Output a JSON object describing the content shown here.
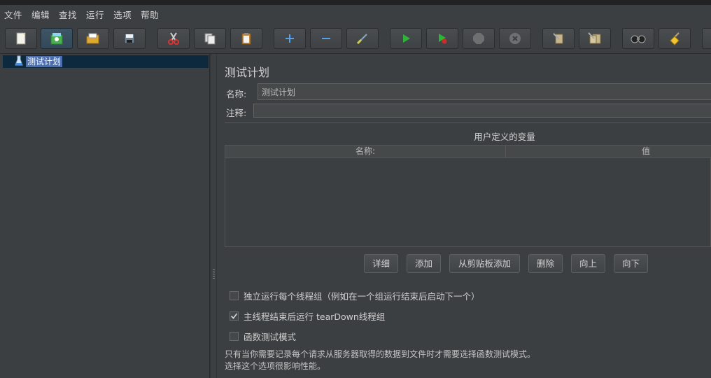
{
  "menu": [
    "文件",
    "编辑",
    "查找",
    "运行",
    "选项",
    "帮助"
  ],
  "toolbar": [
    {
      "name": "new-icon"
    },
    {
      "name": "templates-icon"
    },
    {
      "name": "open-icon"
    },
    {
      "name": "save-icon"
    },
    {
      "name": "cut-icon"
    },
    {
      "name": "copy-icon"
    },
    {
      "name": "paste-icon"
    },
    {
      "name": "expand-icon"
    },
    {
      "name": "collapse-icon"
    },
    {
      "name": "toggle-icon"
    },
    {
      "name": "start-icon"
    },
    {
      "name": "start-no-pause-icon"
    },
    {
      "name": "stop-icon"
    },
    {
      "name": "shutdown-icon"
    },
    {
      "name": "clear-icon"
    },
    {
      "name": "clear-all-icon"
    },
    {
      "name": "search-icon"
    },
    {
      "name": "reset-search-icon"
    }
  ],
  "tree": {
    "node_label": "测试计划"
  },
  "main": {
    "title": "测试计划",
    "name_label": "名称:",
    "name_value": "测试计划",
    "comment_label": "注释:",
    "comment_value": "",
    "table_title": "用户定义的变量",
    "columns": [
      "名称:",
      "值"
    ],
    "buttons": [
      "详细",
      "添加",
      "从剪贴板添加",
      "删除",
      "向上",
      "向下"
    ],
    "checkboxes": [
      {
        "label": "独立运行每个线程组（例如在一个组运行结束后启动下一个）",
        "checked": false
      },
      {
        "label": "主线程结束后运行 tearDown线程组",
        "checked": true
      },
      {
        "label": "函数测试模式",
        "checked": false
      }
    ],
    "note_line1": "只有当你需要记录每个请求从服务器取得的数据到文件时才需要选择函数测试模式。",
    "note_line2": "选择这个选项很影响性能。"
  },
  "colors": {
    "background": "#3c3f41",
    "selection": "#4b6eaf",
    "tree_row": "#0d293e"
  }
}
